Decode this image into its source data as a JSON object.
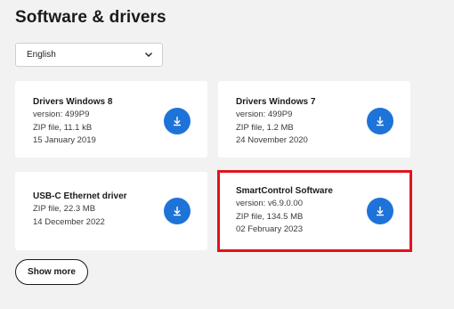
{
  "section": {
    "title": "Software & drivers"
  },
  "language_select": {
    "value": "English"
  },
  "cards": [
    {
      "name": "Drivers Windows 8",
      "lines": [
        "version: 499P9",
        "ZIP file, 11.1 kB",
        "15 January 2019"
      ]
    },
    {
      "name": "Drivers Windows 7",
      "lines": [
        "version: 499P9",
        "ZIP file, 1.2 MB",
        "24 November 2020"
      ]
    },
    {
      "name": "USB-C Ethernet driver",
      "lines": [
        "ZIP file, 22.3 MB",
        "14 December 2022"
      ]
    },
    {
      "name": "SmartControl Software",
      "lines": [
        "version: v6.9.0.00",
        "ZIP file, 134.5 MB",
        "02 February 2023"
      ]
    }
  ],
  "show_more_label": "Show more",
  "colors": {
    "accent": "#1e73d9",
    "highlight": "#e0141e",
    "background": "#f2f2f2"
  },
  "icons": {
    "download": "download-icon",
    "chevron": "chevron-down-icon"
  }
}
